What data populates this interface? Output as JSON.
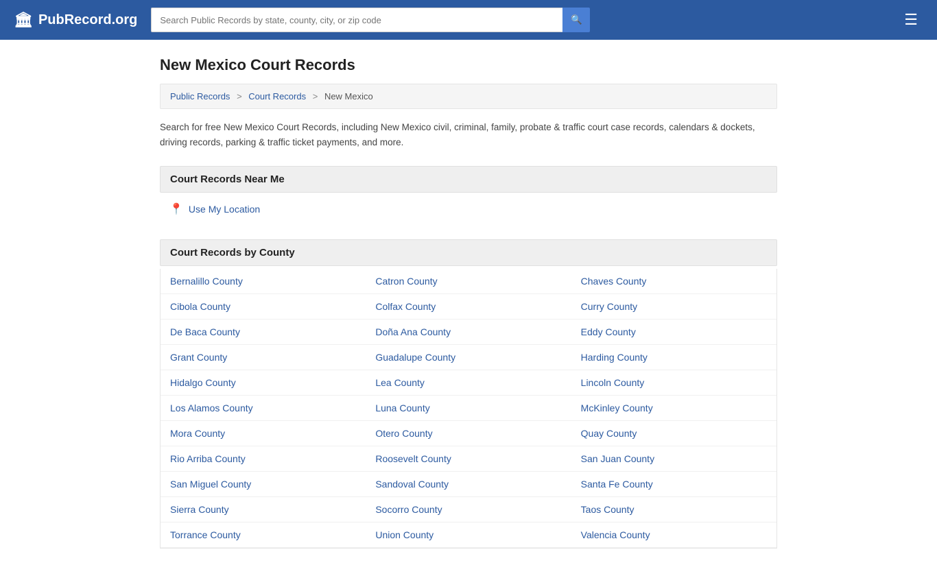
{
  "header": {
    "logo_icon": "🏛",
    "logo_text": "PubRecord.org",
    "search_placeholder": "Search Public Records by state, county, city, or zip code",
    "menu_icon": "☰"
  },
  "page": {
    "title": "New Mexico Court Records",
    "breadcrumb": {
      "items": [
        "Public Records",
        "Court Records",
        "New Mexico"
      ]
    },
    "description": "Search for free New Mexico Court Records, including New Mexico civil, criminal, family, probate & traffic court case records, calendars & dockets, driving records, parking & traffic ticket payments, and more.",
    "near_me_section": {
      "title": "Court Records Near Me",
      "location_label": "Use My Location"
    },
    "county_section": {
      "title": "Court Records by County",
      "counties": [
        "Bernalillo County",
        "Catron County",
        "Chaves County",
        "Cibola County",
        "Colfax County",
        "Curry County",
        "De Baca County",
        "Doña Ana County",
        "Eddy County",
        "Grant County",
        "Guadalupe County",
        "Harding County",
        "Hidalgo County",
        "Lea County",
        "Lincoln County",
        "Los Alamos County",
        "Luna County",
        "McKinley County",
        "Mora County",
        "Otero County",
        "Quay County",
        "Rio Arriba County",
        "Roosevelt County",
        "San Juan County",
        "San Miguel County",
        "Sandoval County",
        "Santa Fe County",
        "Sierra County",
        "Socorro County",
        "Taos County",
        "Torrance County",
        "Union County",
        "Valencia County"
      ]
    }
  }
}
